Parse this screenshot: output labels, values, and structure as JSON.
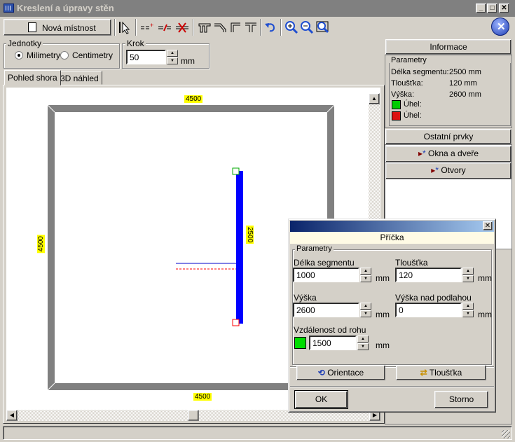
{
  "window": {
    "title": "Kreslení a úpravy stěn"
  },
  "toolbar": {
    "new_room_label": "Nová místnost",
    "tools": [
      "select-tool",
      "wall-split-tool",
      "wall-join-tool",
      "wall-delete-tool",
      "wall-tool-1",
      "wall-tool-2",
      "wall-tool-3",
      "wall-tool-4",
      "undo",
      "zoom-in",
      "zoom-out",
      "zoom-fit"
    ]
  },
  "units": {
    "legend": "Jednotky",
    "millimeters": "Milimetry",
    "centimeters": "Centimetry",
    "selected": "Milimetry"
  },
  "step": {
    "legend": "Krok",
    "value": "50",
    "unit": "mm"
  },
  "tabs": {
    "top_view": "Pohled shora",
    "preview_3d": "3D náhled",
    "active": "Pohled shora"
  },
  "drawing": {
    "top_dimension": "4500",
    "left_dimension": "4500",
    "bottom_dimension": "4500",
    "wall_dimension": "2500",
    "room_wall_color": "#808080",
    "selected_wall_color": "#0000ff",
    "start_handle_color": "#00cc00",
    "end_handle_color": "#ff0000"
  },
  "info_panel": {
    "header": "Informace",
    "params_legend": "Parametry",
    "length_label": "Délka segmentu:",
    "length_value": "2500 mm",
    "thickness_label": "Tloušťka:",
    "thickness_value": "120 mm",
    "height_label": "Výška:",
    "height_value": "2600 mm",
    "angle1_label": "Úhel:",
    "angle2_label": "Úhel:",
    "angle1_color": "#00cc00",
    "angle2_color": "#dd1111",
    "other_header": "Ostatní prvky",
    "windows_doors": "Okna a dveře",
    "openings": "Otvory"
  },
  "dialog": {
    "title": "Příčka",
    "params_legend": "Parametry",
    "length_label": "Délka segmentu",
    "length_value": "1000",
    "thickness_label": "Tloušťka",
    "thickness_value": "120",
    "height_label": "Výška",
    "height_value": "2600",
    "floor_height_label": "Výška nad podlahou",
    "floor_height_value": "0",
    "corner_distance_label": "Vzdálenost od rohu",
    "corner_distance_value": "1500",
    "unit": "mm",
    "orientation_button": "Orientace",
    "thickness_button": "Tloušťka",
    "ok_button": "OK",
    "cancel_button": "Storno",
    "corner_color": "#00dd00"
  }
}
